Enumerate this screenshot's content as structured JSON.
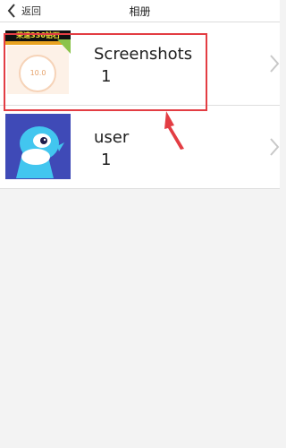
{
  "header": {
    "back_label": "返回",
    "title": "相册"
  },
  "albums": [
    {
      "name": "Screenshots",
      "count": "1",
      "thumb_text": "荣速336钻石",
      "thumb_value": "10.0"
    },
    {
      "name": "user",
      "count": "1"
    }
  ],
  "colors": {
    "highlight": "#e33d43",
    "thumb_bg_user": "#3f4ab7",
    "dolphin": "#42c6ef"
  },
  "icons": {
    "back": "chevron-left-icon",
    "row_chevron": "chevron-right-icon"
  }
}
